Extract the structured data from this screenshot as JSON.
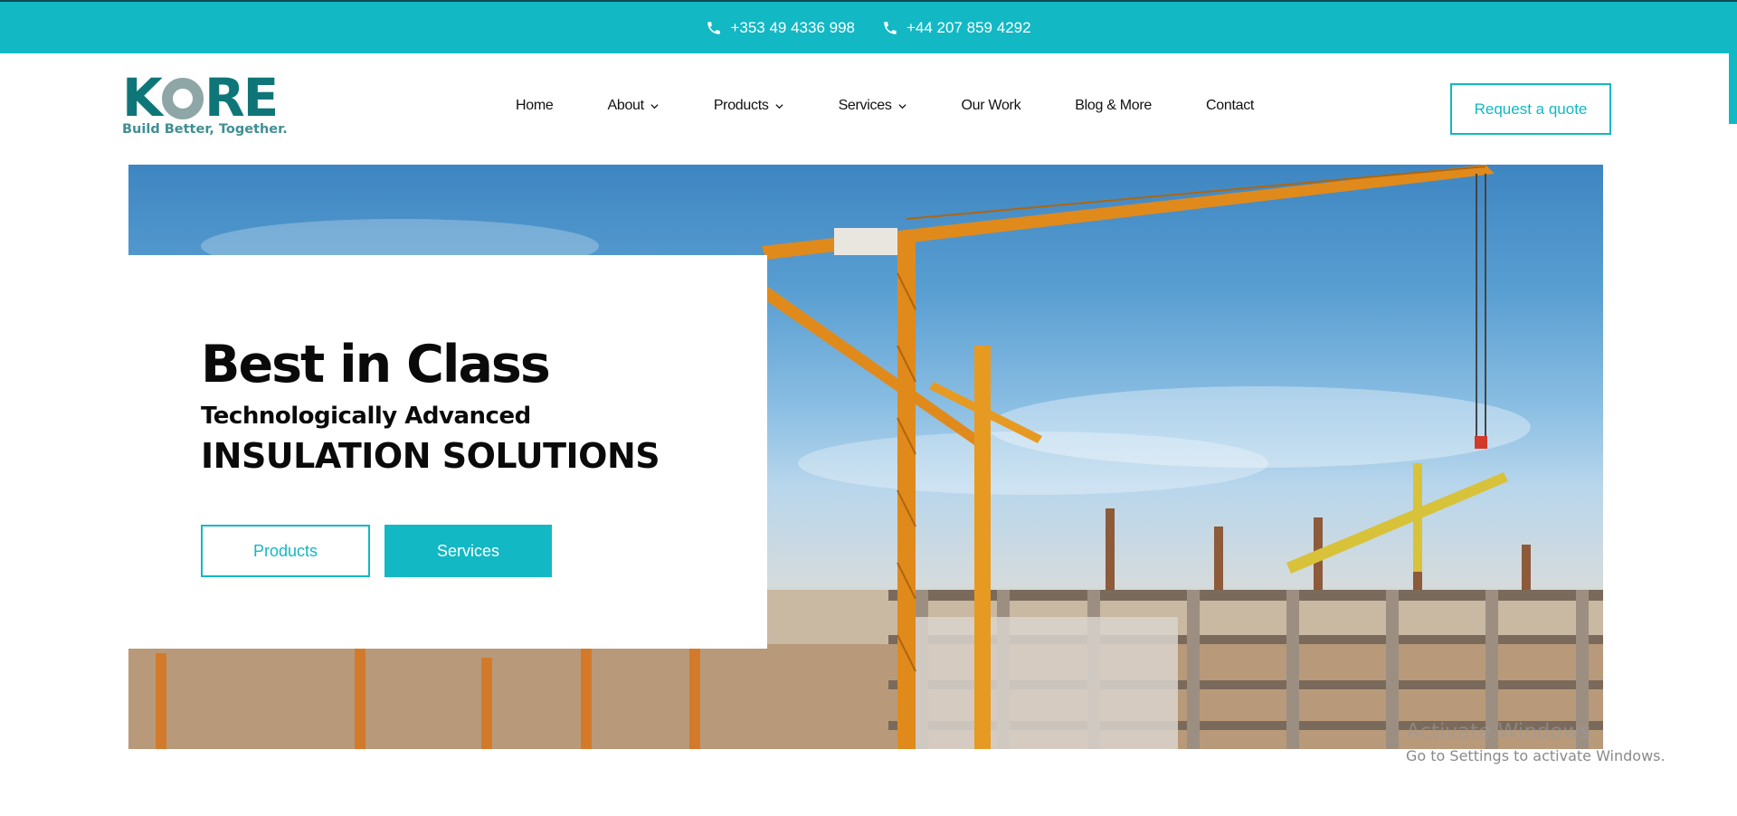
{
  "topbar": {
    "phone1": "+353 49 4336 998",
    "phone2": "+44 207 859 4292",
    "icon": "phone-icon"
  },
  "header": {
    "logo": {
      "name": "KORE",
      "tagline": "Build Better, Together."
    },
    "nav": [
      {
        "label": "Home",
        "has_dropdown": false
      },
      {
        "label": "About",
        "has_dropdown": true
      },
      {
        "label": "Products",
        "has_dropdown": true
      },
      {
        "label": "Services",
        "has_dropdown": true
      },
      {
        "label": "Our Work",
        "has_dropdown": false
      },
      {
        "label": "Blog & More",
        "has_dropdown": false
      },
      {
        "label": "Contact",
        "has_dropdown": false
      }
    ],
    "cta": "Request a quote"
  },
  "hero": {
    "title": "Best in Class",
    "subtitle": "Technologically Advanced",
    "headline": "INSULATION SOLUTIONS",
    "primary_button": "Products",
    "secondary_button": "Services",
    "image": "construction-site-with-tower-cranes"
  },
  "watermark": {
    "title": "Activate Windows",
    "subtitle": "Go to Settings to activate Windows."
  },
  "colors": {
    "accent": "#12b8c4",
    "logo_teal": "#0e7678",
    "logo_grey": "#8fa6a7",
    "text": "#0a0a0a"
  }
}
